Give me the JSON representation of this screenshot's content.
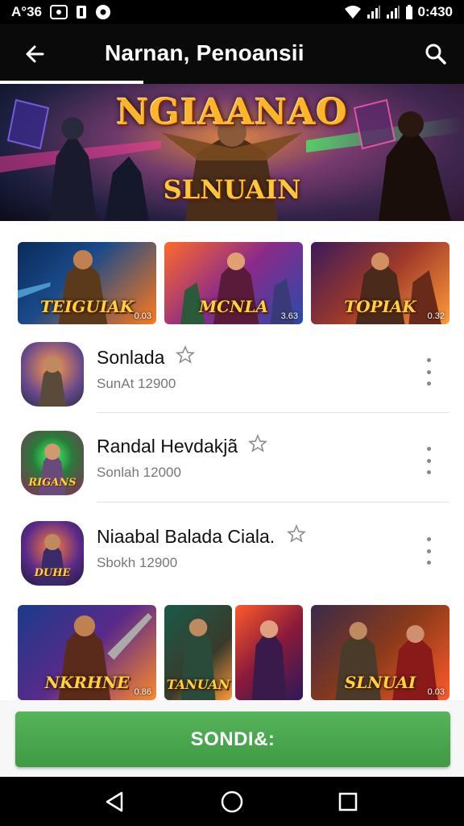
{
  "status_bar": {
    "left_text": "A°36",
    "time": "0:430",
    "icons": [
      "screenshot-icon",
      "sim-icon",
      "notification-dot-icon",
      "wifi-icon",
      "signal-icon",
      "signal-icon",
      "battery-icon"
    ]
  },
  "app_bar": {
    "title": "Narnan, Penoansii",
    "back_icon": "back-arrow-icon",
    "search_icon": "search-icon"
  },
  "hero": {
    "title": "NGIAANAO",
    "subtitle": "SLNUAIN"
  },
  "top_thumbnails": [
    {
      "title": "TEIGUIAK",
      "rating": "0.03"
    },
    {
      "title": "MCNLA",
      "rating": "3.63"
    },
    {
      "title": "TOPIAK",
      "rating": "0.32"
    }
  ],
  "list_items": [
    {
      "name": "Sonlada",
      "meta": "SunAt  12900",
      "icon_text": ""
    },
    {
      "name": "Randal Hevdakjã",
      "meta": "Sonlah  12000",
      "icon_text": "RIGANS"
    },
    {
      "name": "Niaabal Balada Ciala.",
      "meta": "Sbokh  12900",
      "icon_text": "DUHE"
    }
  ],
  "bottom_thumbnails": [
    {
      "title": "NKRHNE",
      "rating": "0.86"
    },
    {
      "title": "TANUAN",
      "rating": ""
    },
    {
      "title": "",
      "rating": ""
    },
    {
      "title": "SLNUAI",
      "rating": "0.03"
    }
  ],
  "action_button": {
    "label": "SONDI&:"
  },
  "nav_bar": {
    "icons": [
      "back-triangle-icon",
      "home-circle-icon",
      "recents-square-icon"
    ]
  },
  "colors": {
    "status_bar": "#000000",
    "app_bar": "#0a0a0a",
    "action_button": "#4caf50",
    "meta_text": "#777777",
    "hero_title": "#ffb52a"
  }
}
